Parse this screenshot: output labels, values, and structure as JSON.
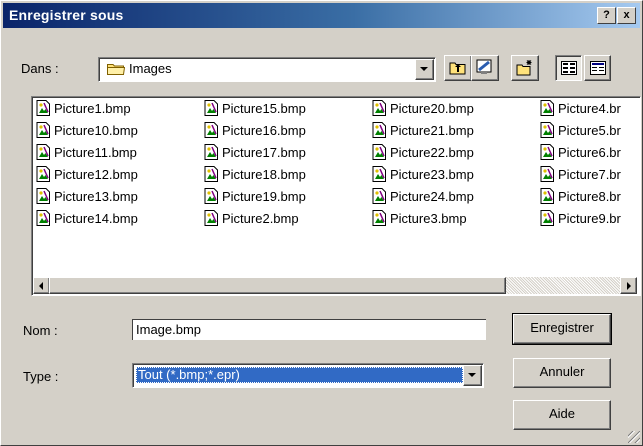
{
  "window": {
    "title": "Enregistrer sous"
  },
  "titlebar_buttons": {
    "help": "?",
    "close": "x"
  },
  "location": {
    "label": "Dans :",
    "value": "Images",
    "icon": "folder-icon"
  },
  "toolbar": {
    "icons": [
      "up-folder-icon",
      "desktop-icon",
      "new-folder-icon",
      "list-view-icon",
      "details-view-icon"
    ]
  },
  "files": [
    "Picture1.bmp",
    "Picture10.bmp",
    "Picture11.bmp",
    "Picture12.bmp",
    "Picture13.bmp",
    "Picture14.bmp",
    "Picture15.bmp",
    "Picture16.bmp",
    "Picture17.bmp",
    "Picture18.bmp",
    "Picture19.bmp",
    "Picture2.bmp",
    "Picture20.bmp",
    "Picture21.bmp",
    "Picture22.bmp",
    "Picture23.bmp",
    "Picture24.bmp",
    "Picture3.bmp",
    "Picture4.br",
    "Picture5.br",
    "Picture6.br",
    "Picture7.br",
    "Picture8.br",
    "Picture9.br"
  ],
  "form": {
    "name_label": "Nom :",
    "name_value": "Image.bmp",
    "type_label": "Type :",
    "type_value": "Tout (*.bmp;*.epr)"
  },
  "buttons": {
    "save": "Enregistrer",
    "cancel": "Annuler",
    "help": "Aide"
  },
  "colors": {
    "titlebar_start": "#0a246a",
    "titlebar_end": "#a6caf0",
    "face": "#d4d0c8",
    "selection": "#316ac5"
  }
}
